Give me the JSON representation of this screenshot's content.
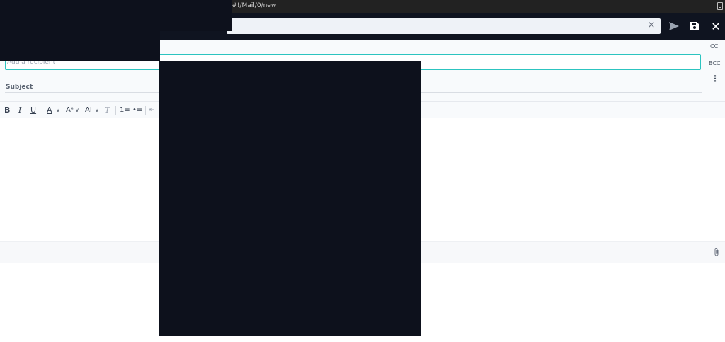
{
  "browser": {
    "url": "v#!/Mail/0/new"
  },
  "header": {
    "clear_label": "×",
    "close_label": "✕"
  },
  "compose": {
    "to_placeholder": "Add a recipient",
    "cc_label": "CC",
    "bcc_label": "BCC",
    "more_label": "⋮",
    "subject_label": "Subject"
  },
  "toolbar": {
    "bold": "B",
    "italic": "I",
    "underline": "U",
    "font_color": "A",
    "font_size": "Aᵃ",
    "font_family": "AI",
    "clear_format": "T",
    "ordered_list": "1≡",
    "bullet_list": "•≡",
    "outdent": "⇤",
    "caret": "∨"
  },
  "colors": {
    "header_bg": "#0f1420",
    "accent": "#2cc4c0",
    "redaction": "#0d111c"
  }
}
